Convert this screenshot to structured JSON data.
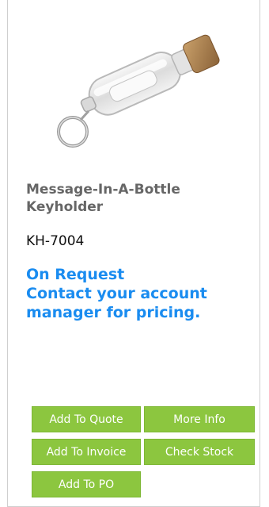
{
  "product": {
    "title": "Message-In-A-Bottle Keyholder",
    "sku": "KH-7004",
    "availability": "On Request",
    "pricing_note_line1": "Contact your account",
    "pricing_note_line2": "manager for pricing.",
    "image_alt": "bottle-keychain-image"
  },
  "actions": {
    "add_to_quote": "Add To Quote",
    "more_info": "More Info",
    "add_to_invoice": "Add To Invoice",
    "check_stock": "Check Stock",
    "add_to_po": "Add To PO"
  },
  "colors": {
    "button_bg": "#8cc63f",
    "accent_blue": "#1a8cf0",
    "title_gray": "#666666"
  }
}
